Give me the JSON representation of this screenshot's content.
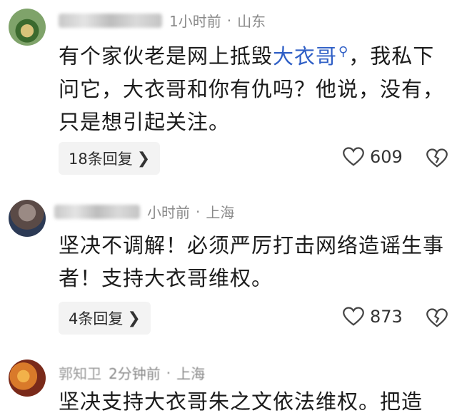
{
  "comments": [
    {
      "time": "1小时前",
      "location": "山东",
      "text_prefix": "有个家伙老是网上抵毁",
      "text_link": "大衣哥",
      "link_icon": "search-icon",
      "text_suffix": "，我私下问它，大衣哥和你有仇吗？他说，没有，只是想引起关注。",
      "replies": "18条回复",
      "likes": "609",
      "avatar_colors": [
        "#7fa36a",
        "#3b6a2e",
        "#d9c37a"
      ]
    },
    {
      "time": "小时前",
      "location": "上海",
      "text": "坚决不调解！必须严厉打击网络造谣生事者！支持大衣哥维权。",
      "replies": "4条回复",
      "likes": "873",
      "avatar_colors": [
        "#5a4a46",
        "#9a8a84",
        "#2c3a55"
      ]
    },
    {
      "username": "郭知卫",
      "time": "2分钟前",
      "location": "上海",
      "text": "坚决支持大衣哥朱之文依法维权。把造",
      "avatar_colors": [
        "#d97a2a",
        "#7a2a1a",
        "#f2b24a"
      ]
    }
  ],
  "separator": "·",
  "icons": {
    "like": "heart-icon",
    "dislike": "broken-heart-icon",
    "reply_chevron": "chevron-right-icon"
  },
  "colors": {
    "link": "#2f5fc6",
    "meta": "#8a8a8a",
    "reply_bg": "#f3f3f3"
  }
}
